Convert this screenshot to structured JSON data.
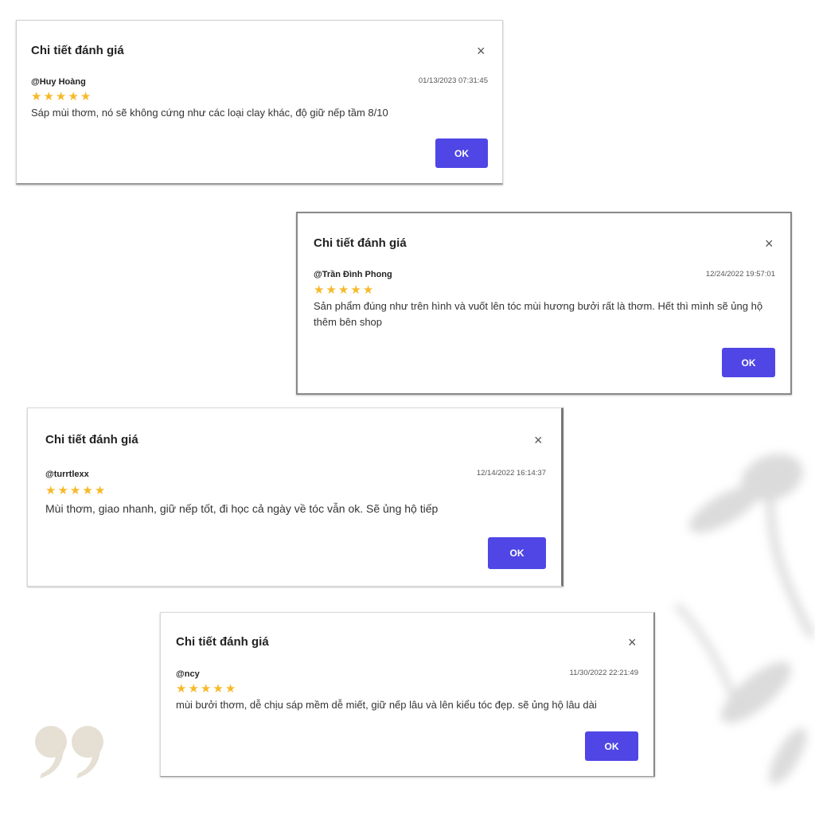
{
  "reviews": [
    {
      "title": "Chi tiết đánh giá",
      "user": "@Huy Hoàng",
      "date": "01/13/2023 07:31:45",
      "rating": 5,
      "comment": "Sáp mùi thơm, nó sẽ không cứng như các loại clay khác, độ giữ nếp tầm 8/10",
      "ok_label": "OK"
    },
    {
      "title": "Chi tiết đánh giá",
      "user": "@Trần Đình Phong",
      "date": "12/24/2022 19:57:01",
      "rating": 5,
      "comment": "Sản phẩm đúng như trên hình và vuốt lên tóc mùi hương bưởi rất là thơm. Hết thì mình sẽ ủng hộ thêm bên shop",
      "ok_label": "OK"
    },
    {
      "title": "Chi tiết đánh giá",
      "user": "@turrtlexx",
      "date": "12/14/2022 16:14:37",
      "rating": 5,
      "comment": "Mùi thơm, giao nhanh, giữ nếp tốt, đi học cả ngày về tóc vẫn ok. Sẽ ủng hộ tiếp",
      "ok_label": "OK"
    },
    {
      "title": "Chi tiết đánh giá",
      "user": "@ncy",
      "date": "11/30/2022 22:21:49",
      "rating": 5,
      "comment": "mùi bưởi thơm, dễ chịu sáp mềm dễ miết, giữ nếp lâu và lên kiểu tóc đẹp. sẽ ủng hộ lâu dài",
      "ok_label": "OK"
    }
  ],
  "icons": {
    "close": "close-icon",
    "star": "star-icon",
    "quote": "quote-icon"
  },
  "colors": {
    "accent": "#4f46e5",
    "star": "#f7b928",
    "quote": "#e6dfd3"
  }
}
